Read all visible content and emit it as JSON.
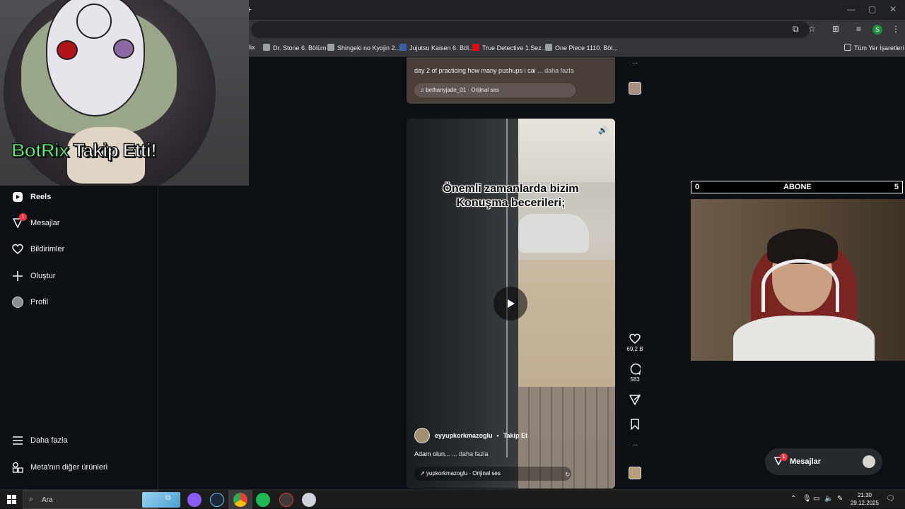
{
  "browser": {
    "new_tab": "+",
    "window_controls": {
      "minimize": "—",
      "maximize": "▢",
      "close": "✕"
    },
    "profile_initial": "S",
    "bookmarks": [
      {
        "label": "lix",
        "left": 0
      },
      {
        "label": "Dr. Stone 6. Bölüm"
      },
      {
        "label": "Shingeki no Kyojin 2..."
      },
      {
        "label": "Jujutsu Kaisen 6. Böl..."
      },
      {
        "label": "True Detective 1.Sez..."
      },
      {
        "label": "One Piece 1110. Böl..."
      }
    ],
    "all_bookmarks": "Tüm Yer İşaretleri"
  },
  "sidebar": {
    "items": [
      {
        "label": "Reels",
        "bold": true
      },
      {
        "label": "Mesajlar",
        "badge": "1"
      },
      {
        "label": "Bildirimler"
      },
      {
        "label": "Oluştur"
      },
      {
        "label": "Profil"
      }
    ],
    "more": "Daha fazla",
    "meta": "Meta'nın diğer ürünleri"
  },
  "prev_post": {
    "caption": "day 2 of practicing how many pushups i cai",
    "more": "... daha fazla",
    "audio": "bethanyjade_01 · Orijinal ses"
  },
  "reel": {
    "overlay_line1": "Önemli zamanlarda bizim",
    "overlay_line2": "Konuşma becerileri;",
    "author": "eyyupkorkmazoglu",
    "dot": "•",
    "follow": "Takip Et",
    "caption": "Adam olun...",
    "more": "... daha fazla",
    "audio": "↗ yupkorkmazoglu · Orijinal ses",
    "likes": "69,2 B",
    "comments": "583"
  },
  "stream": {
    "alert_bot": "BotRix",
    "alert_rest": " Takip Etti!",
    "abone_left": "0",
    "abone_label": "ABONE",
    "abone_right": "5"
  },
  "messages_pill": {
    "label": "Mesajlar",
    "badge": "1"
  },
  "taskbar": {
    "search": "Ara",
    "time": "21:30",
    "date": "29.12.2025"
  },
  "colors": {
    "page_bg": "#0c1014",
    "badge_red": "#ff3040",
    "alert_green": "#5cf07a"
  }
}
